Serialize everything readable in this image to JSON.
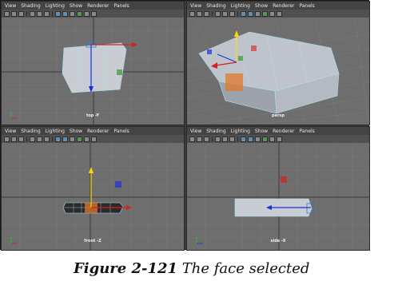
{
  "menu": [
    "View",
    "Shading",
    "Lighting",
    "Show",
    "Renderer",
    "Panels"
  ],
  "viewports": {
    "top": {
      "camera_label": "top -Y"
    },
    "persp": {
      "camera_label": "persp"
    },
    "front": {
      "camera_label": "front -Z"
    },
    "side": {
      "camera_label": "side -X"
    }
  },
  "caption": {
    "number": "Figure 2-121",
    "text": "The face selected"
  },
  "colors": {
    "mesh": "#c9ccd3",
    "selected_face": "#e07a2a",
    "manipulator_x": "#d42020",
    "manipulator_y": "#ffd800",
    "manipulator_z": "#1c2fd8",
    "grid_bg": "#6e6e6e",
    "grid_line": "#7a7a7a"
  },
  "icons": [
    "menu-icon",
    "camera-icon",
    "grid-icon",
    "wireframe-icon",
    "smooth-shade-icon",
    "texture-icon",
    "light-icon",
    "isolate-icon"
  ]
}
